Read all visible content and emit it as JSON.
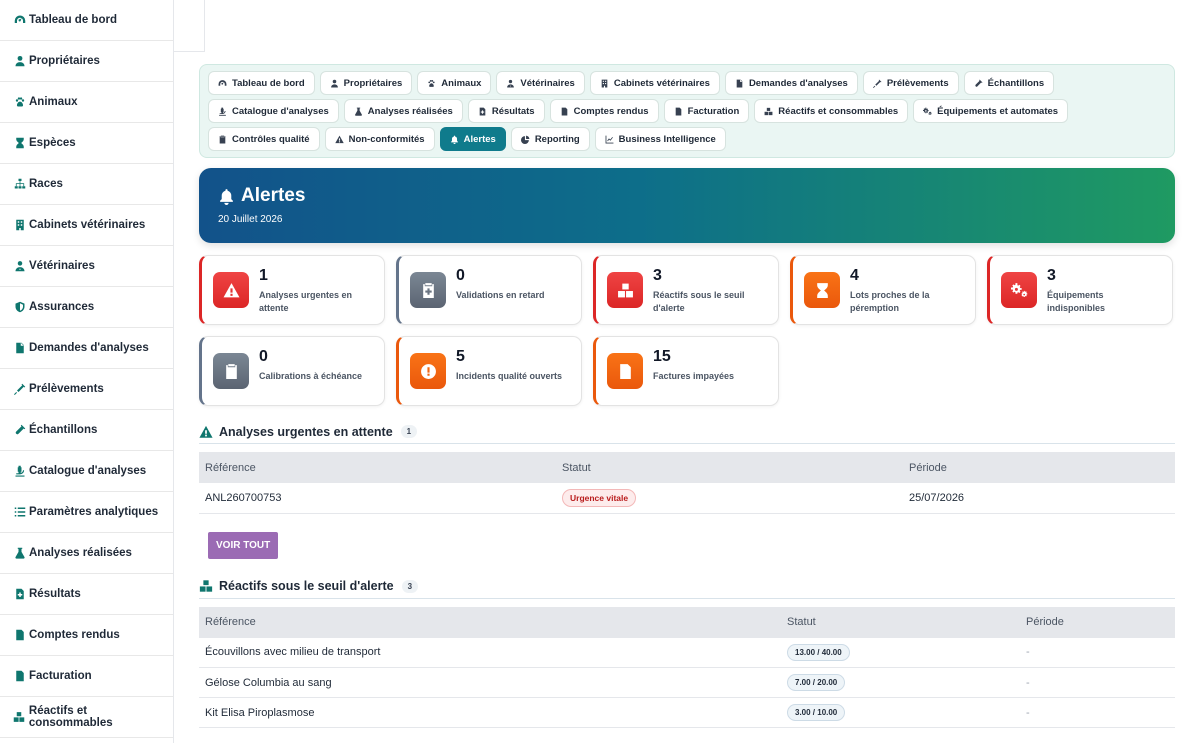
{
  "sidebar": {
    "items": [
      {
        "label": "Tableau de bord",
        "icon": "dashboard-icon"
      },
      {
        "label": "Propriétaires",
        "icon": "user-icon"
      },
      {
        "label": "Animaux",
        "icon": "paw-icon"
      },
      {
        "label": "Espèces",
        "icon": "hourglass-icon"
      },
      {
        "label": "Races",
        "icon": "sitemap-icon"
      },
      {
        "label": "Cabinets vétérinaires",
        "icon": "building-icon"
      },
      {
        "label": "Vétérinaires",
        "icon": "doctor-icon"
      },
      {
        "label": "Assurances",
        "icon": "shield-icon"
      },
      {
        "label": "Demandes d'analyses",
        "icon": "file-icon"
      },
      {
        "label": "Prélèvements",
        "icon": "syringe-icon"
      },
      {
        "label": "Échantillons",
        "icon": "vial-icon"
      },
      {
        "label": "Catalogue d'analyses",
        "icon": "microscope-icon"
      },
      {
        "label": "Paramètres analytiques",
        "icon": "list-icon"
      },
      {
        "label": "Analyses réalisées",
        "icon": "flask-icon"
      },
      {
        "label": "Résultats",
        "icon": "file-medical-icon"
      },
      {
        "label": "Comptes rendus",
        "icon": "file-signature-icon"
      },
      {
        "label": "Facturation",
        "icon": "invoice-icon"
      },
      {
        "label": "Réactifs et consommables",
        "icon": "boxes-icon"
      }
    ]
  },
  "tabs": [
    {
      "label": "Tableau de bord",
      "icon": "dashboard-icon"
    },
    {
      "label": "Propriétaires",
      "icon": "user-icon"
    },
    {
      "label": "Animaux",
      "icon": "paw-icon"
    },
    {
      "label": "Vétérinaires",
      "icon": "doctor-icon"
    },
    {
      "label": "Cabinets vétérinaires",
      "icon": "building-icon"
    },
    {
      "label": "Demandes d'analyses",
      "icon": "file-icon"
    },
    {
      "label": "Prélèvements",
      "icon": "syringe-icon"
    },
    {
      "label": "Échantillons",
      "icon": "vial-icon"
    },
    {
      "label": "Catalogue d'analyses",
      "icon": "microscope-icon"
    },
    {
      "label": "Analyses réalisées",
      "icon": "flask-icon"
    },
    {
      "label": "Résultats",
      "icon": "file-medical-icon"
    },
    {
      "label": "Comptes rendus",
      "icon": "file-signature-icon"
    },
    {
      "label": "Facturation",
      "icon": "invoice-icon"
    },
    {
      "label": "Réactifs et consommables",
      "icon": "boxes-icon"
    },
    {
      "label": "Équipements et automates",
      "icon": "cogs-icon"
    },
    {
      "label": "Contrôles qualité",
      "icon": "clipboard-check-icon"
    },
    {
      "label": "Non-conformités",
      "icon": "warning-icon"
    },
    {
      "label": "Alertes",
      "icon": "bell-icon",
      "active": true
    },
    {
      "label": "Reporting",
      "icon": "chart-pie-icon"
    },
    {
      "label": "Business Intelligence",
      "icon": "chart-line-icon"
    }
  ],
  "header": {
    "title": "Alertes",
    "date": "20 Juillet 2026",
    "icon": "bell-icon"
  },
  "cards": [
    {
      "value": "1",
      "label": "Analyses urgentes en attente",
      "icon": "warning-icon",
      "tone": "red"
    },
    {
      "value": "0",
      "label": "Validations en retard",
      "icon": "clipboard-medical-icon",
      "tone": "gray"
    },
    {
      "value": "3",
      "label": "Réactifs sous le seuil d'alerte",
      "icon": "boxes-icon",
      "tone": "red"
    },
    {
      "value": "4",
      "label": "Lots proches de la péremption",
      "icon": "hourglass-icon",
      "tone": "orange"
    },
    {
      "value": "3",
      "label": "Équipements indisponibles",
      "icon": "cogs-icon",
      "tone": "red"
    },
    {
      "value": "0",
      "label": "Calibrations à échéance",
      "icon": "clipboard-check-icon",
      "tone": "gray"
    },
    {
      "value": "5",
      "label": "Incidents qualité ouverts",
      "icon": "exclamation-circle-icon",
      "tone": "orange"
    },
    {
      "value": "15",
      "label": "Factures impayées",
      "icon": "invoice-icon",
      "tone": "orange"
    }
  ],
  "colors": {
    "accent": "#0f766e",
    "active_tab": "#0f7b8c",
    "danger": "#dc2626",
    "warning": "#ea580c",
    "neutral": "#64748b",
    "button": "#9b6bb4"
  },
  "urgent": {
    "title": "Analyses urgentes en attente",
    "count": "1",
    "columns": [
      "Référence",
      "Statut",
      "Période"
    ],
    "rows": [
      {
        "reference": "ANL260700753",
        "status": "Urgence vitale",
        "period": "25/07/2026"
      }
    ],
    "button": "VOIR TOUT"
  },
  "reagents": {
    "title": "Réactifs sous le seuil d'alerte",
    "count": "3",
    "columns": [
      "Référence",
      "Statut",
      "Période"
    ],
    "rows": [
      {
        "reference": "Écouvillons avec milieu de transport",
        "status": "13.00 / 40.00",
        "period": "-"
      },
      {
        "reference": "Gélose Columbia au sang",
        "status": "7.00 / 20.00",
        "period": "-"
      },
      {
        "reference": "Kit Elisa Piroplasmose",
        "status": "3.00 / 10.00",
        "period": "-"
      }
    ]
  }
}
